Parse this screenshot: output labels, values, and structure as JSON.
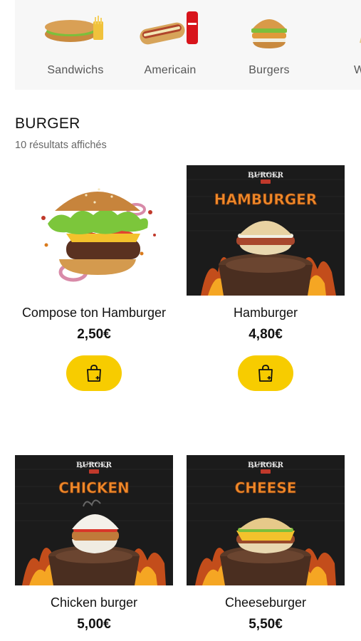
{
  "categories": [
    {
      "label": "Sandwichs",
      "icon": "sandwich-icon"
    },
    {
      "label": "Americain",
      "icon": "hotdog-icon"
    },
    {
      "label": "Burgers",
      "icon": "burger-icon"
    },
    {
      "label": "W",
      "icon": "wrap-icon"
    }
  ],
  "section": {
    "title": "BURGER",
    "results": "10 résultats affichés"
  },
  "products": [
    {
      "name": "Compose ton Hamburger",
      "price": "2,50€",
      "poster_logo": "",
      "poster_title": ""
    },
    {
      "name": "Hamburger",
      "price": "4,80€",
      "poster_logo": "BURGER",
      "poster_title": "HAMBURGER"
    },
    {
      "name": "Chicken burger",
      "price": "5,00€",
      "poster_logo": "BURGER",
      "poster_title": "CHICKEN"
    },
    {
      "name": "Cheeseburger",
      "price": "5,50€",
      "poster_logo": "BURGER",
      "poster_title": "CHEESE"
    }
  ],
  "colors": {
    "accent": "#f7cc00",
    "poster_bg": "#1b1b1b",
    "poster_title": "#f08a2a"
  }
}
